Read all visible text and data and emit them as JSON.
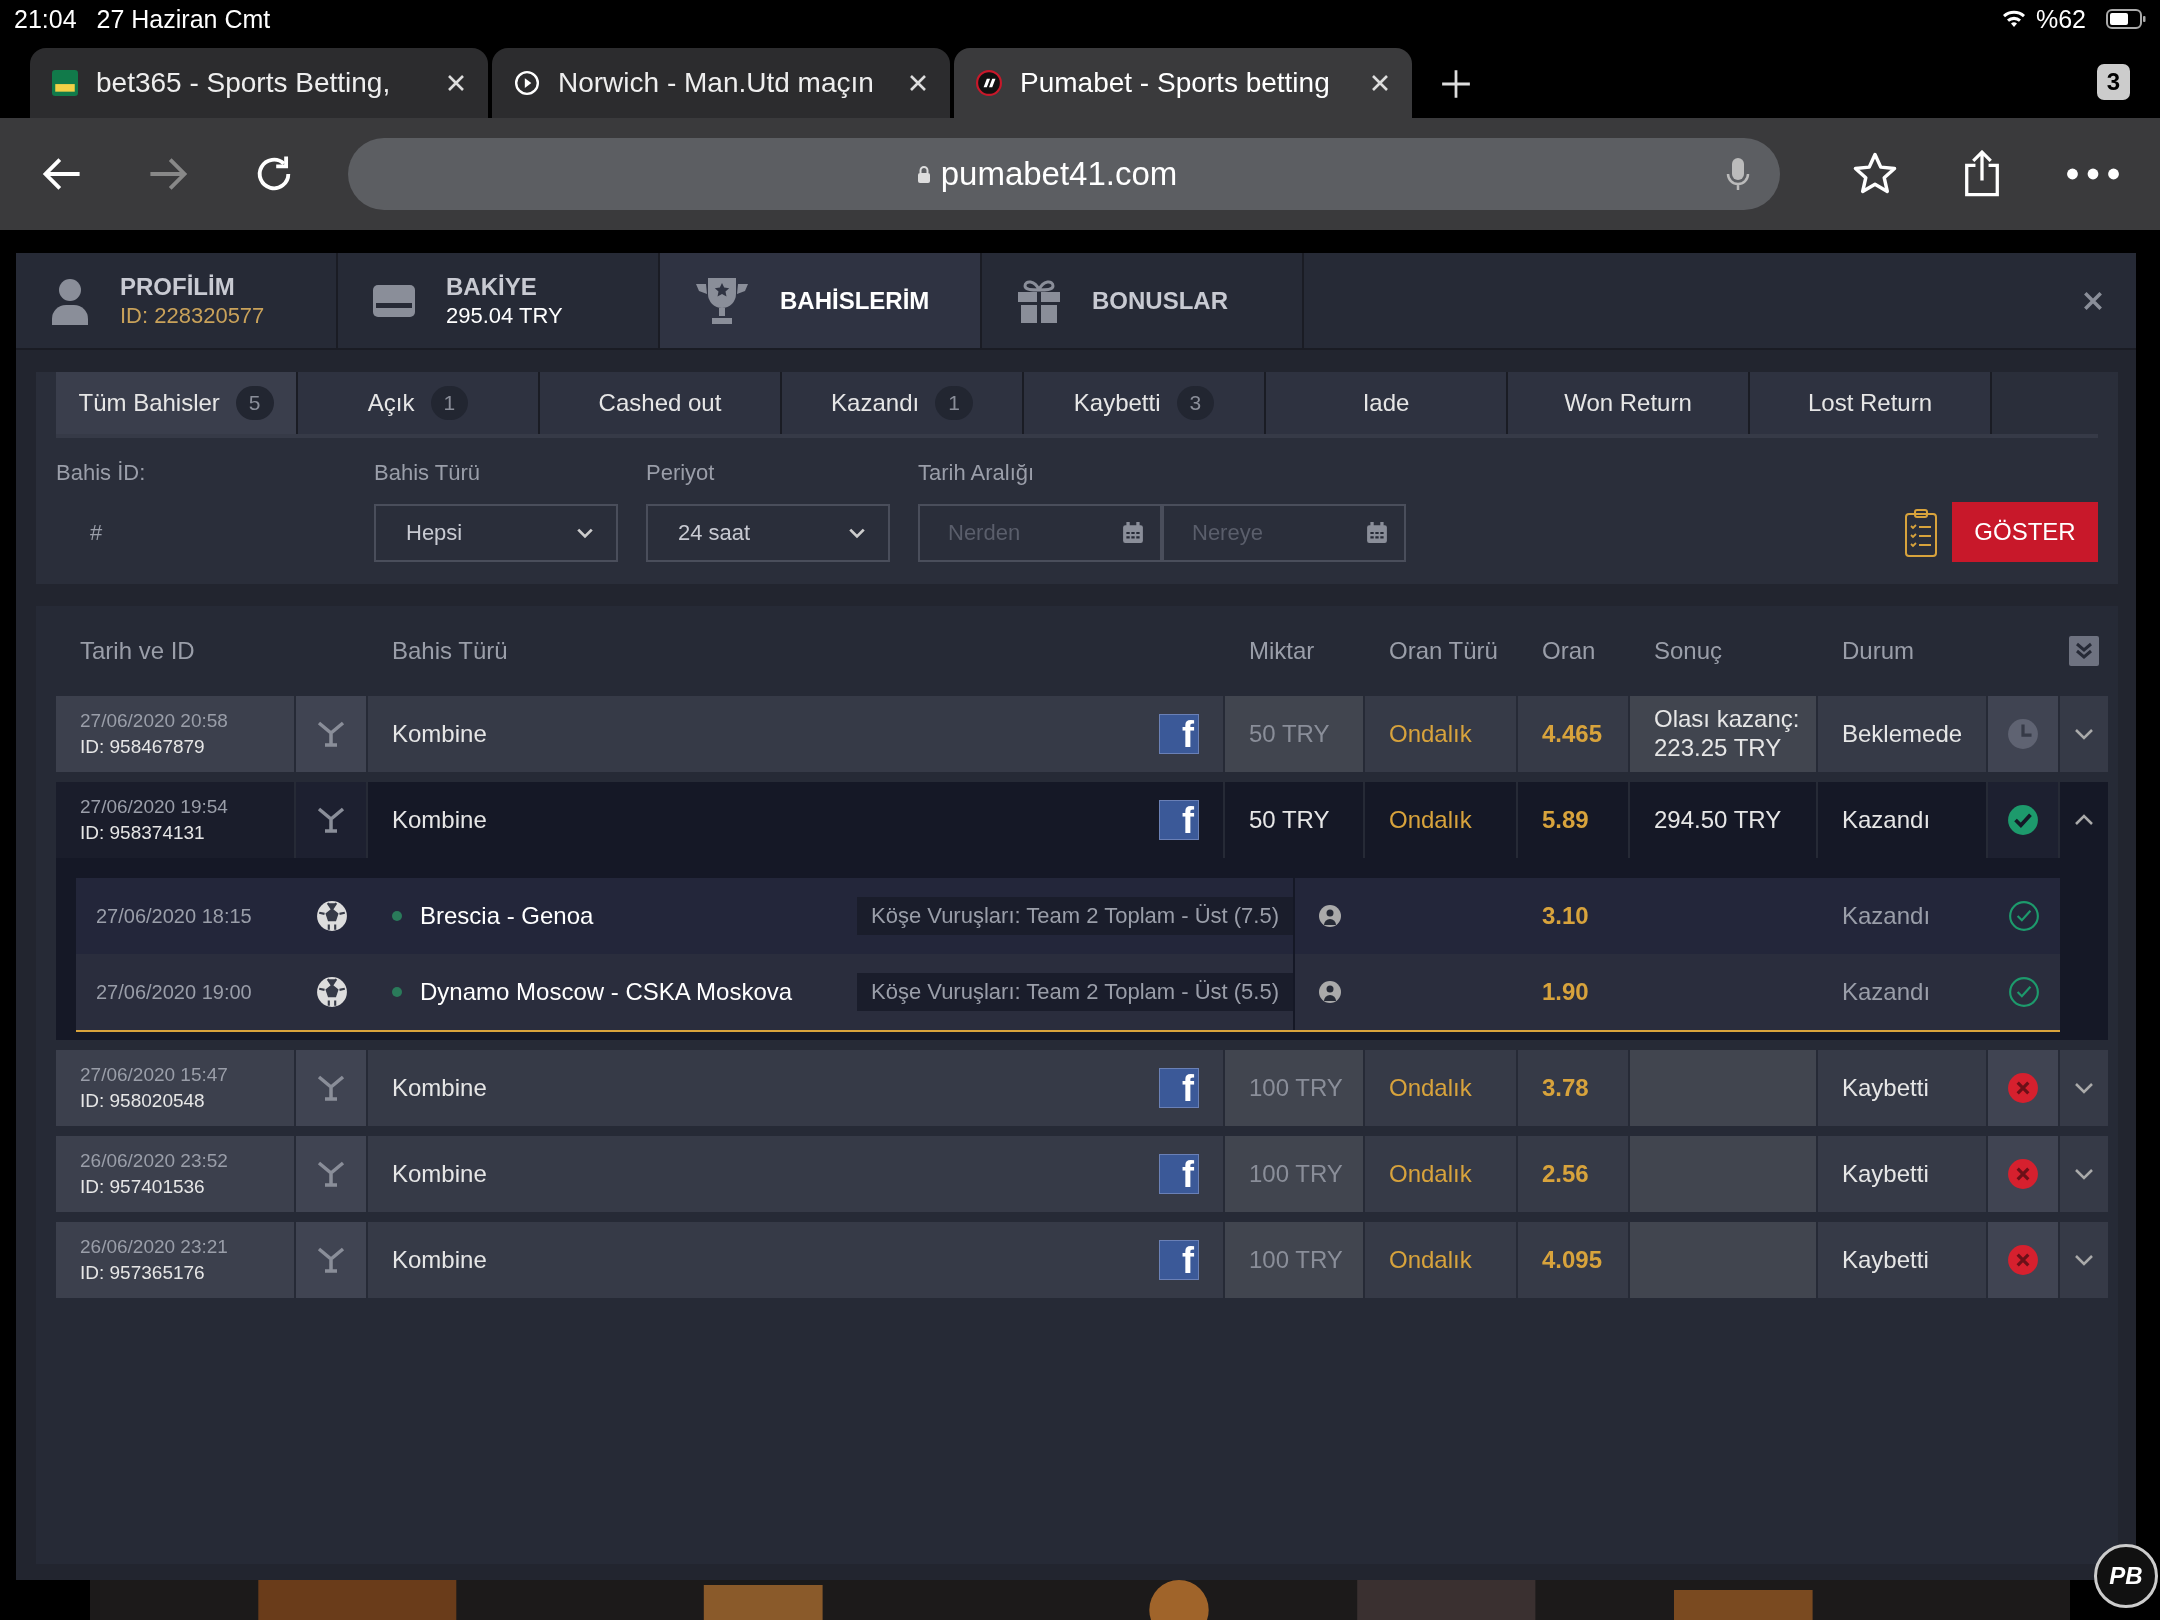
{
  "status_bar": {
    "time": "21:04",
    "date": "27 Haziran Cmt",
    "battery": "%62"
  },
  "browser": {
    "tabs": [
      {
        "title": "bet365 - Sports Betting,",
        "kind": "green",
        "selected": false
      },
      {
        "title": "Norwich - Man.Utd maçın",
        "kind": "play",
        "selected": false
      },
      {
        "title": "Pumabet - Sports betting",
        "kind": "puma",
        "selected": true
      }
    ],
    "tab_count": "3",
    "url": "pumabet41.com"
  },
  "header_tabs": [
    {
      "title": "PROFİLİM",
      "subtitle": "ID: 228320577",
      "kind": "user",
      "selected": false
    },
    {
      "title": "BAKİYE",
      "subtitle": "295.04 TRY",
      "kind": "wallet",
      "selected": false
    },
    {
      "title": "BAHİSLERİM",
      "kind": "trophy",
      "selected": true
    },
    {
      "title": "BONUSLAR",
      "kind": "gift",
      "selected": false
    }
  ],
  "filter_tabs": [
    {
      "label": "Tüm Bahisler",
      "count": "5",
      "selected": true
    },
    {
      "label": "Açık",
      "count": "1",
      "selected": false
    },
    {
      "label": "Cashed out",
      "selected": false
    },
    {
      "label": "Kazandı",
      "count": "1",
      "selected": false
    },
    {
      "label": "Kaybetti",
      "count": "3",
      "selected": false
    },
    {
      "label": "Iade",
      "selected": false
    },
    {
      "label": "Won Return",
      "selected": false
    },
    {
      "label": "Lost Return",
      "selected": false
    }
  ],
  "filters": {
    "bet_id_label": "Bahis İD:",
    "bet_id_placeholder": "#",
    "type_label": "Bahis Türü",
    "type_value": "Hepsi",
    "period_label": "Periyot",
    "period_value": "24 saat",
    "date_label": "Tarih Aralığı",
    "from_placeholder": "Nerden",
    "to_placeholder": "Nereye",
    "show_button": "GÖSTER"
  },
  "table": {
    "columns": [
      "Tarih ve ID",
      "Bahis Türü",
      "Miktar",
      "Oran Türü",
      "Oran",
      "Sonuç",
      "Durum"
    ],
    "rows": [
      {
        "date": "27/06/2020 20:58",
        "id": "ID: 958467879",
        "type": "Kombine",
        "share": "f",
        "amount": "50 TRY",
        "odds_type": "Ondalık",
        "odds": "4.465",
        "result": "Olası kazanç: 223.25 TRY",
        "status": "Beklemede",
        "kind": "pending",
        "expanded": false
      },
      {
        "date": "27/06/2020 19:54",
        "id": "ID: 958374131",
        "type": "Kombine",
        "share": "f",
        "amount": "50 TRY",
        "odds_type": "Ondalık",
        "odds": "5.89",
        "result": "294.50 TRY",
        "status": "Kazandı",
        "kind": "won",
        "expanded": true,
        "selections": [
          {
            "date": "27/06/2020 18:15",
            "match": "Brescia - Genoa",
            "market": "Köşe Vuruşları: Team 2 Toplam - Üst (7.5)",
            "odds": "3.10",
            "status": "Kazandı",
            "kind": "won"
          },
          {
            "date": "27/06/2020 19:00",
            "match": "Dynamo Moscow - CSKA Moskova",
            "market": "Köşe Vuruşları: Team 2 Toplam - Üst (5.5)",
            "odds": "1.90",
            "status": "Kazandı",
            "kind": "won"
          }
        ]
      },
      {
        "date": "27/06/2020 15:47",
        "id": "ID: 958020548",
        "type": "Kombine",
        "share": "f",
        "amount": "100 TRY",
        "odds_type": "Ondalık",
        "odds": "3.78",
        "status": "Kaybetti",
        "kind": "lost",
        "expanded": false
      },
      {
        "date": "26/06/2020 23:52",
        "id": "ID: 957401536",
        "type": "Kombine",
        "share": "f",
        "amount": "100 TRY",
        "odds_type": "Ondalık",
        "odds": "2.56",
        "status": "Kaybetti",
        "kind": "lost",
        "expanded": false
      },
      {
        "date": "26/06/2020 23:21",
        "id": "ID: 957365176",
        "type": "Kombine",
        "share": "f",
        "amount": "100 TRY",
        "odds_type": "Ondalık",
        "odds": "4.095",
        "status": "Kaybetti",
        "kind": "lost",
        "expanded": false
      }
    ]
  },
  "chat_button": {
    "label": "PB"
  }
}
